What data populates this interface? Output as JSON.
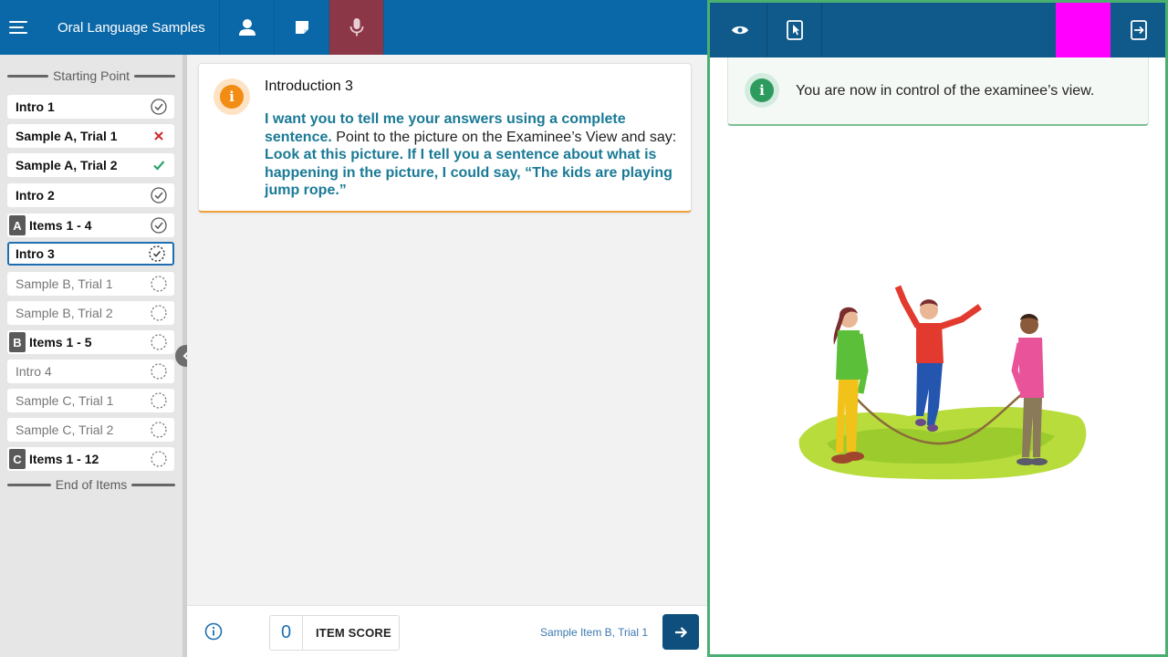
{
  "app": {
    "title": "Oral Language Samples"
  },
  "sidebar": {
    "start_label": "Starting Point",
    "end_label": "End of Items",
    "items": [
      {
        "label": "Intro 1",
        "status": "complete"
      },
      {
        "label": "Sample A, Trial 1",
        "status": "incorrect"
      },
      {
        "label": "Sample A, Trial 2",
        "status": "correct"
      },
      {
        "label": "Intro 2",
        "status": "complete"
      },
      {
        "label": "Items 1 - 4",
        "letter": "A",
        "status": "complete"
      },
      {
        "label": "Intro 3",
        "status": "in-progress"
      },
      {
        "label": "Sample B, Trial 1",
        "status": "pending"
      },
      {
        "label": "Sample B, Trial 2",
        "status": "pending"
      },
      {
        "label": "Items 1 - 5",
        "letter": "B",
        "status": "pending"
      },
      {
        "label": "Intro 4",
        "status": "pending"
      },
      {
        "label": "Sample C, Trial 1",
        "status": "pending"
      },
      {
        "label": "Sample C, Trial 2",
        "status": "pending"
      },
      {
        "label": "Items 1 - 12",
        "letter": "C",
        "status": "pending"
      }
    ]
  },
  "card": {
    "title": "Introduction 3",
    "em1": "I want you to tell me your answers using a complete sentence.",
    "plain": " Point to the picture on the Examinee’s View and say: ",
    "em2": "Look at this picture. If I tell you a sentence about what is happening in the picture, I could say, “The kids are playing jump rope.”"
  },
  "bottom": {
    "score_value": "0",
    "score_label": "ITEM SCORE",
    "next_item": "Sample Item B, Trial 1"
  },
  "examinee": {
    "notice": "You are now in control of the examinee’s view."
  },
  "colors": {
    "topbar": "#0b68a8",
    "active_tab": "#8c3748",
    "examinee_bar": "#0f5a8a",
    "highlight": "#ff00ff",
    "accent_orange": "#f28c13",
    "accent_green": "#2d9b5e",
    "text_emphasis": "#1a7a96"
  },
  "icons": {
    "menu": "hamburger-icon",
    "examiner": "person-icon",
    "notes": "note-icon",
    "record": "microphone-icon",
    "view": "eye-icon",
    "touch": "tablet-pointer-icon",
    "exit": "exit-screen-icon"
  }
}
